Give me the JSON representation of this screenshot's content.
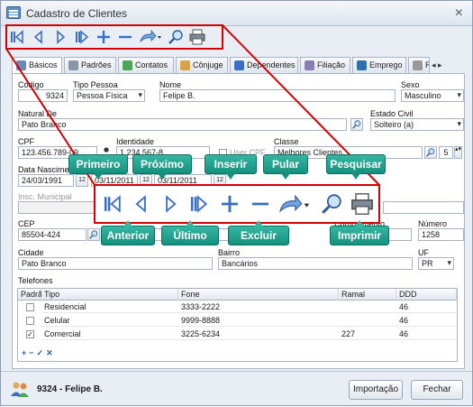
{
  "window": {
    "title": "Cadastro de Clientes",
    "close_glyph": "×"
  },
  "tabs": [
    {
      "label": "Básicos",
      "icon": "document-icon"
    },
    {
      "label": "Padrões",
      "icon": "table-icon"
    },
    {
      "label": "Contatos",
      "icon": "contacts-icon"
    },
    {
      "label": "Cônjuge",
      "icon": "spouse-icon"
    },
    {
      "label": "Dependentes",
      "icon": "dependents-icon"
    },
    {
      "label": "Filiação",
      "icon": "parents-icon"
    },
    {
      "label": "Emprego",
      "icon": "job-icon"
    },
    {
      "label": "R",
      "icon": "reference-icon"
    }
  ],
  "form": {
    "codigo_label": "Código",
    "codigo_value": "9324",
    "tipo_pessoa_label": "Tipo Pessoa",
    "tipo_pessoa_value": "Pessoa Física",
    "nome_label": "Nome",
    "nome_value": "Felipe B.",
    "sexo_label": "Sexo",
    "sexo_value": "Masculino",
    "natural_label": "Natural De",
    "natural_value": "Pato Branco",
    "estado_civil_label": "Estado Civil",
    "estado_civil_value": "Solteiro (a)",
    "cpf_label": "CPF",
    "cpf_value": "123.456.789-09",
    "identidade_label": "Identidade",
    "identidade_value": "1.234.567-8",
    "user_cpf_label": "User CPF",
    "classe_label": "Classe",
    "classe_value": "Melhores Clientes",
    "classe_code": "5",
    "data_nasc_label": "Data Nascimen",
    "data_nasc_value": "24/03/1991",
    "date2_value": "03/11/2011",
    "date3_value": "03/11/2011",
    "insc_municipal_label": "Insc. Municipal",
    "cep_label": "CEP",
    "cep_value": "85504-424",
    "complemento_label": "Complemento",
    "numero_label": "Número",
    "numero_value": "1258",
    "cidade_label": "Cidade",
    "cidade_value": "Pato Branco",
    "bairro_label": "Bairro",
    "bairro_value": "Bancários",
    "uf_label": "UF",
    "uf_value": "PR",
    "telefones_label": "Telefones"
  },
  "phones": {
    "headers": [
      "Padrã",
      "Tipo",
      "Fone",
      "Ramal",
      "DDD"
    ],
    "rows": [
      {
        "padrao": false,
        "tipo": "Residencial",
        "fone": "3333-2222",
        "ramal": "",
        "ddd": "46"
      },
      {
        "padrao": false,
        "tipo": "Celular",
        "fone": "9999-8888",
        "ramal": "",
        "ddd": "46"
      },
      {
        "padrao": true,
        "tipo": "Comercial",
        "fone": "3225-6234",
        "ramal": "227",
        "ddd": "46"
      }
    ],
    "nav": [
      "+",
      "−",
      "✓",
      "✕"
    ]
  },
  "footer": {
    "record_code": "9324",
    "record_name": "Felipe B.",
    "separator": "-",
    "import_button": "Importação",
    "close_button": "Fechar"
  },
  "callouts": {
    "primeiro": "Primeiro",
    "proximo": "Próximo",
    "inserir": "Inserir",
    "pular": "Pular",
    "pesquisar": "Pesquisar",
    "anterior": "Anterior",
    "ultimo": "Último",
    "excluir": "Excluir",
    "imprimir": "Imprimir"
  },
  "colors": {
    "highlight": "#d40000",
    "callout": "#1fa18c",
    "icon_blue": "#3b6fc4"
  }
}
